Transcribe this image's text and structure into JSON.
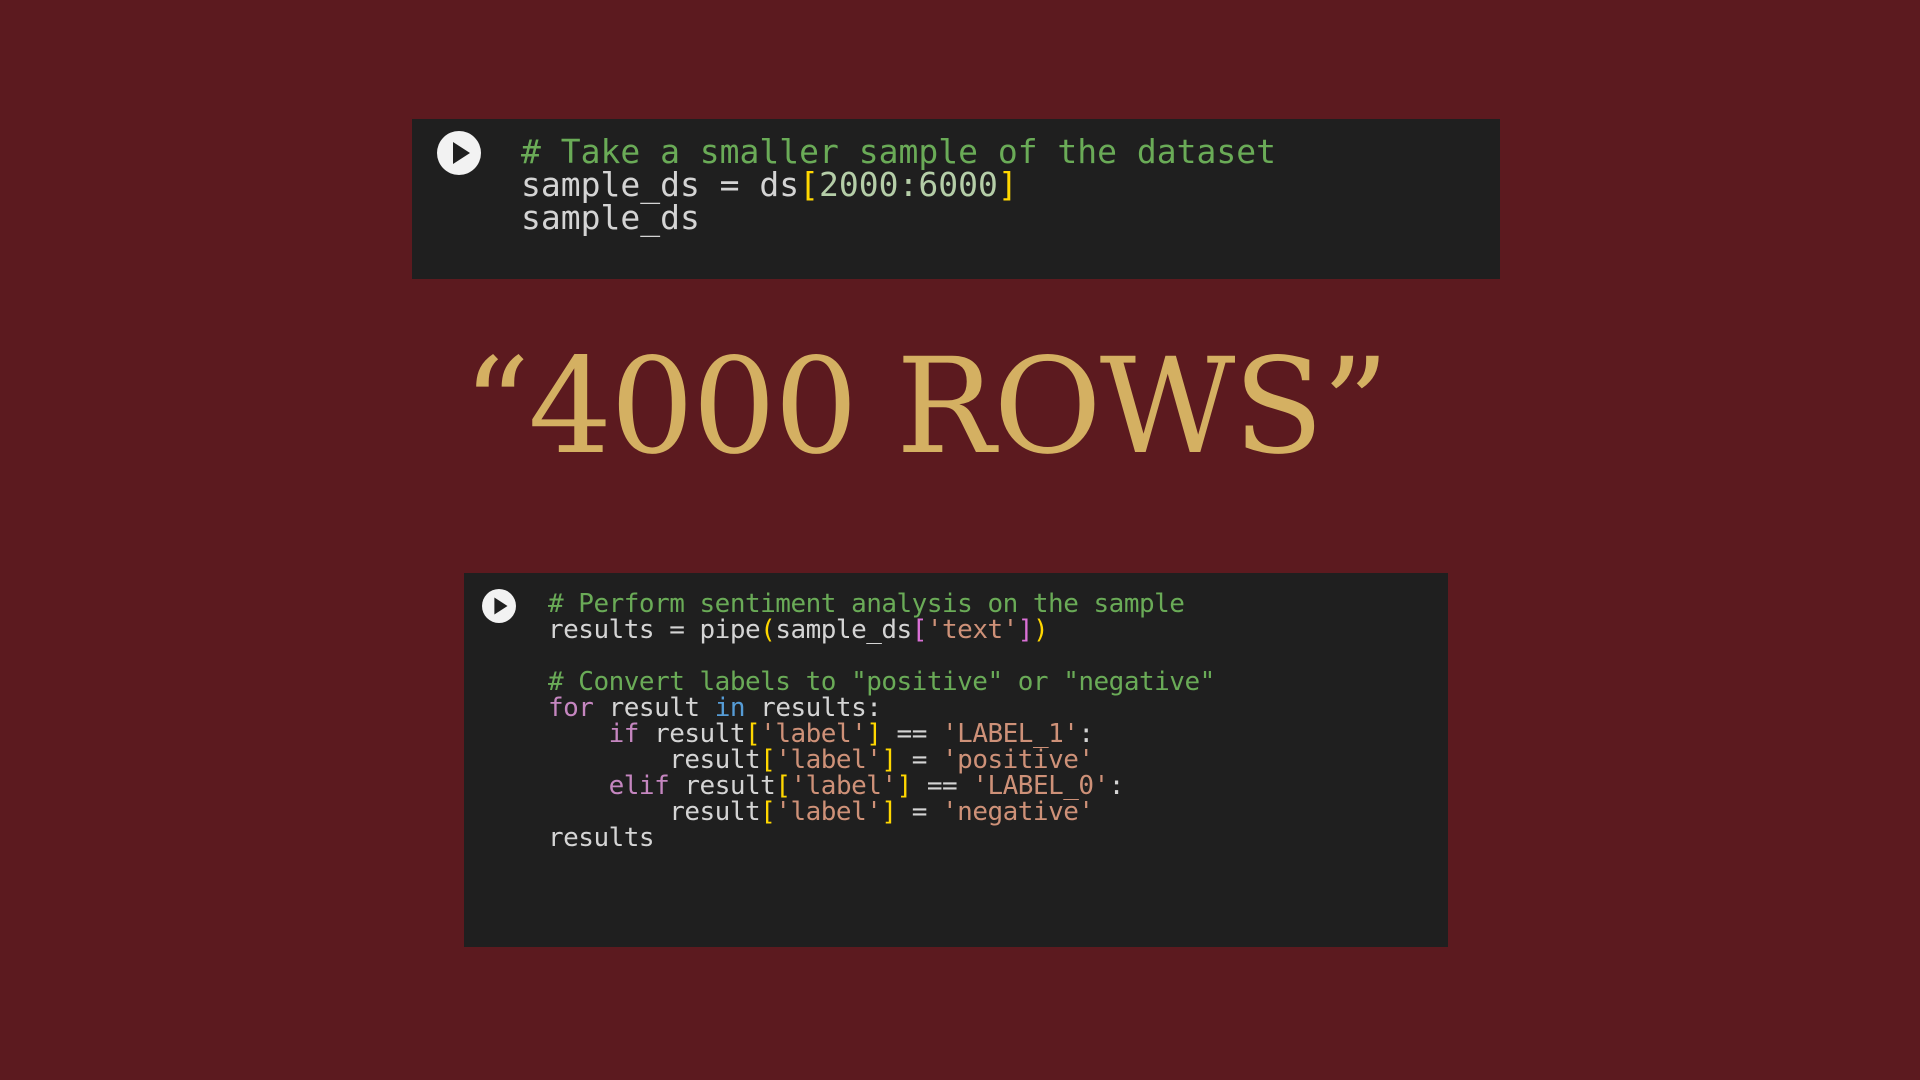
{
  "colors": {
    "background": "#5c1a1f",
    "cell": "#1f1f1f",
    "title": "#d4b062"
  },
  "title": "“4000 ROWS”",
  "cells": [
    {
      "run_icon": "play-icon",
      "lines": [
        [
          [
            "comment",
            "# Take a smaller sample of the dataset"
          ]
        ],
        [
          [
            "default",
            "sample_ds = ds"
          ],
          [
            "bracket",
            "["
          ],
          [
            "number",
            "2000:6000"
          ],
          [
            "bracket",
            "]"
          ]
        ],
        [
          [
            "default",
            "sample_ds"
          ]
        ]
      ]
    },
    {
      "run_icon": "play-icon",
      "lines": [
        [
          [
            "comment",
            "# Perform sentiment analysis on the sample"
          ]
        ],
        [
          [
            "default",
            "results = pipe"
          ],
          [
            "bracket",
            "("
          ],
          [
            "default",
            "sample_ds"
          ],
          [
            "bracket2",
            "["
          ],
          [
            "string",
            "'text'"
          ],
          [
            "bracket2",
            "]"
          ],
          [
            "bracket",
            ")"
          ]
        ],
        [],
        [
          [
            "comment",
            "# Convert labels to \"positive\" or \"negative\""
          ]
        ],
        [
          [
            "keyword",
            "for"
          ],
          [
            "default",
            " result "
          ],
          [
            "kwblue",
            "in"
          ],
          [
            "default",
            " results:"
          ]
        ],
        [
          [
            "default",
            "    "
          ],
          [
            "keyword",
            "if"
          ],
          [
            "default",
            " result"
          ],
          [
            "bracket",
            "["
          ],
          [
            "string",
            "'label'"
          ],
          [
            "bracket",
            "]"
          ],
          [
            "default",
            " == "
          ],
          [
            "string",
            "'LABEL_1'"
          ],
          [
            "default",
            ":"
          ]
        ],
        [
          [
            "default",
            "        result"
          ],
          [
            "bracket",
            "["
          ],
          [
            "string",
            "'label'"
          ],
          [
            "bracket",
            "]"
          ],
          [
            "default",
            " = "
          ],
          [
            "string",
            "'positive'"
          ]
        ],
        [
          [
            "default",
            "    "
          ],
          [
            "keyword",
            "elif"
          ],
          [
            "default",
            " result"
          ],
          [
            "bracket",
            "["
          ],
          [
            "string",
            "'label'"
          ],
          [
            "bracket",
            "]"
          ],
          [
            "default",
            " == "
          ],
          [
            "string",
            "'LABEL_0'"
          ],
          [
            "default",
            ":"
          ]
        ],
        [
          [
            "default",
            "        result"
          ],
          [
            "bracket",
            "["
          ],
          [
            "string",
            "'label'"
          ],
          [
            "bracket",
            "]"
          ],
          [
            "default",
            " = "
          ],
          [
            "string",
            "'negative'"
          ]
        ],
        [
          [
            "default",
            "results"
          ]
        ]
      ]
    }
  ]
}
